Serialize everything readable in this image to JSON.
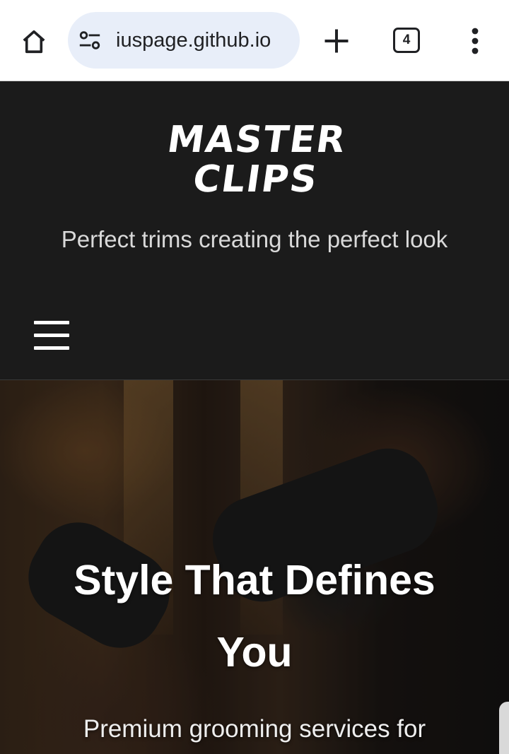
{
  "browser": {
    "url": "iuspage.github.io",
    "tab_count": "4",
    "icons": [
      "home-icon",
      "site-settings-icon",
      "new-tab-icon",
      "tab-switcher-icon",
      "more-vert-icon"
    ]
  },
  "header": {
    "logo_line1": "MASTER",
    "logo_line2": "CLIPS",
    "tagline": "Perfect trims creating the perfect look",
    "menu_icon": "hamburger-icon"
  },
  "hero": {
    "title": "Style That Defines You",
    "subtitle": "Premium grooming services for"
  },
  "colors": {
    "header_bg": "#1b1b1b",
    "chrome_bg": "#ffffff",
    "omnibox_bg": "#e8eef9",
    "text_light": "#d9d9d9"
  }
}
